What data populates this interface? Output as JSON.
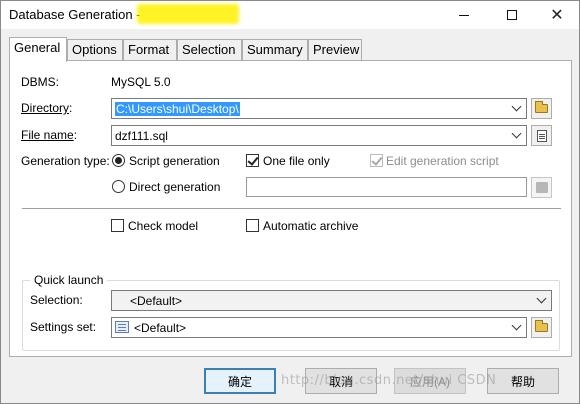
{
  "window": {
    "title": "Database Generation -",
    "controls": {
      "minimize_icon": "minimize-icon",
      "maximize_icon": "maximize-icon",
      "close_icon": "close-icon",
      "close_glyph": "✕"
    }
  },
  "tabs": [
    {
      "label": "General",
      "active": true
    },
    {
      "label": "Options",
      "active": false
    },
    {
      "label": "Format",
      "active": false
    },
    {
      "label": "Selection",
      "active": false
    },
    {
      "label": "Summary",
      "active": false
    },
    {
      "label": "Preview",
      "active": false
    }
  ],
  "general": {
    "dbms_label": "DBMS:",
    "dbms_value": "MySQL 5.0",
    "directory_label": "Directory",
    "directory_label_suffix": ":",
    "directory_value": "C:\\Users\\shui\\Desktop\\",
    "filename_label": "File name",
    "filename_label_suffix": ":",
    "filename_value": "dzf111.sql",
    "generation_type_label": "Generation type:",
    "script_generation_label": "Script generation",
    "script_generation_selected": true,
    "direct_generation_label": "Direct generation",
    "direct_generation_selected": false,
    "one_file_only_label": "One file only",
    "one_file_only_checked": true,
    "edit_generation_script_label": "Edit generation script",
    "edit_generation_script_checked": true,
    "edit_generation_script_enabled": false,
    "direct_generation_value": "",
    "check_model_label": "Check model",
    "check_model_checked": false,
    "automatic_archive_label": "Automatic archive",
    "automatic_archive_checked": false
  },
  "quick_launch": {
    "title": "Quick launch",
    "selection_label": "Selection:",
    "selection_value": "<Default>",
    "settings_set_label": "Settings set:",
    "settings_set_value": "<Default>"
  },
  "buttons": {
    "ok": "确定",
    "cancel": "取消",
    "apply": "应用(A)",
    "help": "帮助"
  },
  "watermark": "http://blog.csdn.net/shui CSDN",
  "colors": {
    "selection_highlight": "#3399ff",
    "default_button_border": "#3c7fb1",
    "title_redaction": "#fff200"
  }
}
